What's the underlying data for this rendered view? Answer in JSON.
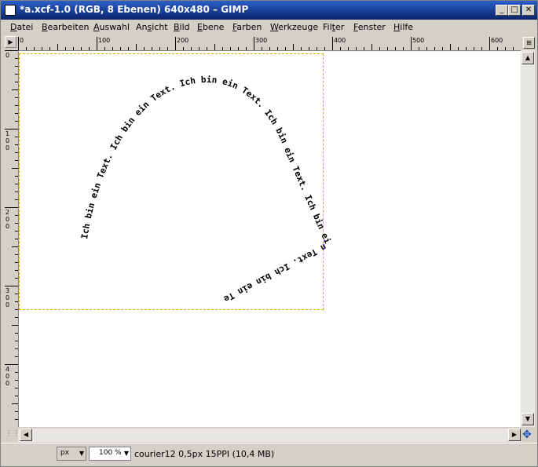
{
  "window": {
    "title": "*a.xcf-1.0 (RGB, 8 Ebenen) 640x480 – GIMP",
    "minimize_glyph": "_",
    "maximize_glyph": "□",
    "close_glyph": "✕"
  },
  "menu": [
    {
      "label": "Datei",
      "mnemonic_index": 0
    },
    {
      "label": "Bearbeiten",
      "mnemonic_index": 0
    },
    {
      "label": "Auswahl",
      "mnemonic_index": 0
    },
    {
      "label": "Ansicht",
      "mnemonic_index": 2
    },
    {
      "label": "Bild",
      "mnemonic_index": 0
    },
    {
      "label": "Ebene",
      "mnemonic_index": 0
    },
    {
      "label": "Farben",
      "mnemonic_index": 0
    },
    {
      "label": "Werkzeuge",
      "mnemonic_index": 0
    },
    {
      "label": "Filter",
      "mnemonic_index": 3
    },
    {
      "label": "Fenster",
      "mnemonic_index": 0
    },
    {
      "label": "Hilfe",
      "mnemonic_index": 0
    }
  ],
  "hruler": {
    "labels": [
      "0",
      "100",
      "200",
      "300",
      "400",
      "500",
      "600"
    ]
  },
  "vruler": {
    "labels": [
      "0",
      "100",
      "200",
      "300",
      "400"
    ]
  },
  "canvas": {
    "text_path": "Ich bin ein Text. Ich bin ein Text. Ich bin ein Text. Ich bin ein Text. Ich bin ein Text. Ich bin ein Te",
    "text_color": "#000000",
    "boundary_color": "#d4b000"
  },
  "status": {
    "unit": "px",
    "zoom": "100 %",
    "info": "courier12 0,5px 15PPI (10,4 MB)"
  }
}
